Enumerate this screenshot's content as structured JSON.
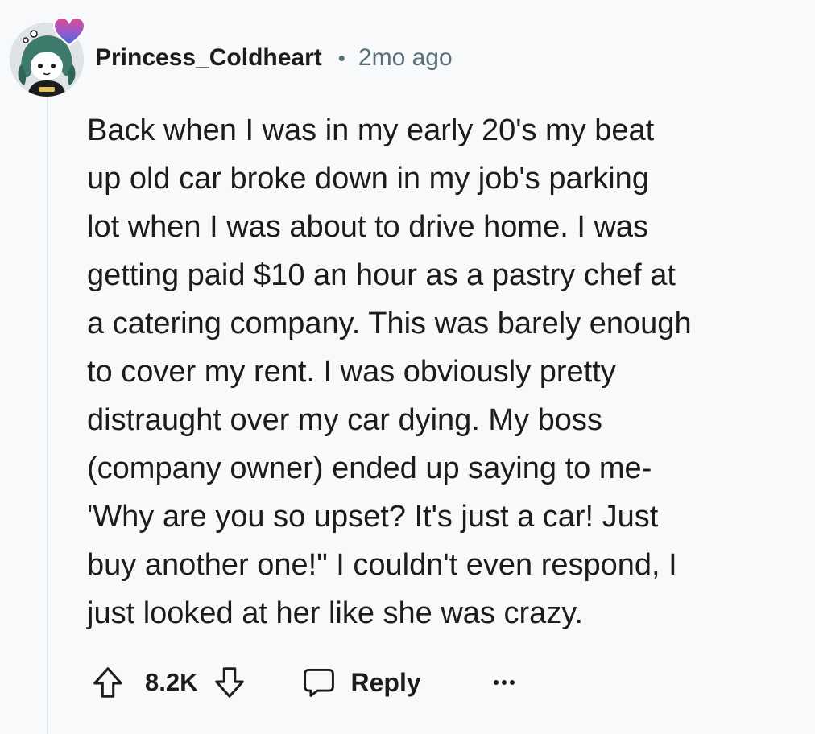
{
  "comment": {
    "author": "Princess_Coldheart",
    "separator": "•",
    "time": "2mo ago",
    "lines": [
      "Back when I was in my early 20's my beat",
      "up old car broke down in my job's parking",
      "lot when I was about to drive home. I was",
      "getting paid $10 an hour as a pastry chef at",
      "a catering company. This was barely enough",
      "to cover my rent. I was obviously pretty",
      "distraught over my car dying. My boss",
      "(company owner) ended up saying to me-",
      "'Why are you so upset? It's just a car! Just",
      "buy another one!\" I couldn't even respond, I",
      "just looked at her like she was crazy."
    ]
  },
  "actions": {
    "score": "8.2K",
    "reply_label": "Reply",
    "more_label": "•••"
  },
  "icons": {
    "upvote": "upvote-arrow-icon",
    "downvote": "downvote-arrow-icon",
    "reply": "speech-bubble-icon",
    "more": "ellipsis-icon"
  },
  "colors": {
    "background": "#f8f9fb",
    "text": "#1c1c1c",
    "meta": "#576f76",
    "thread_line": "#e3e6ea"
  }
}
